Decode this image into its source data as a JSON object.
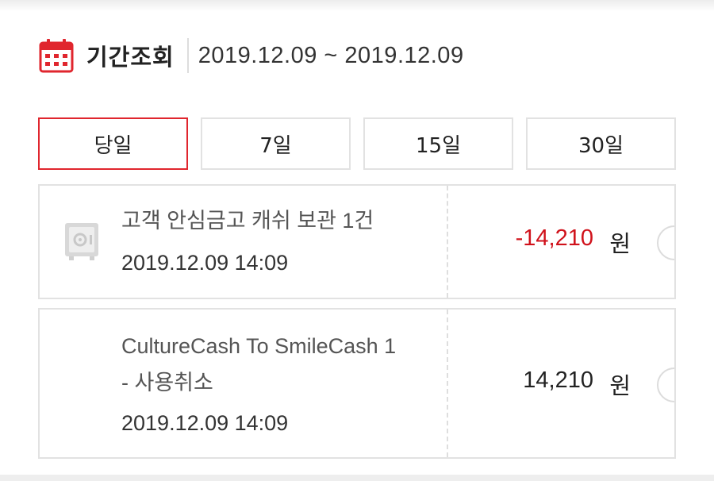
{
  "header": {
    "icon": "calendar-icon",
    "title": "기간조회",
    "date_range": "2019.12.09 ~ 2019.12.09"
  },
  "tabs": [
    {
      "label": "당일",
      "active": true
    },
    {
      "label": "7일",
      "active": false
    },
    {
      "label": "15일",
      "active": false
    },
    {
      "label": "30일",
      "active": false
    }
  ],
  "transactions": [
    {
      "icon": "safe-icon",
      "title": "고객 안심금고 캐쉬 보관 1건",
      "datetime": "2019.12.09 14:09",
      "amount": "-14,210",
      "unit": "원"
    },
    {
      "title_line1": "CultureCash To SmileCash 1",
      "title_line2": "- 사용취소",
      "datetime": "2019.12.09 14:09",
      "amount": "14,210",
      "unit": "원"
    }
  ],
  "colors": {
    "accent": "#e0262e",
    "negative_amount": "#d0121b",
    "border": "#e2e2e2"
  }
}
